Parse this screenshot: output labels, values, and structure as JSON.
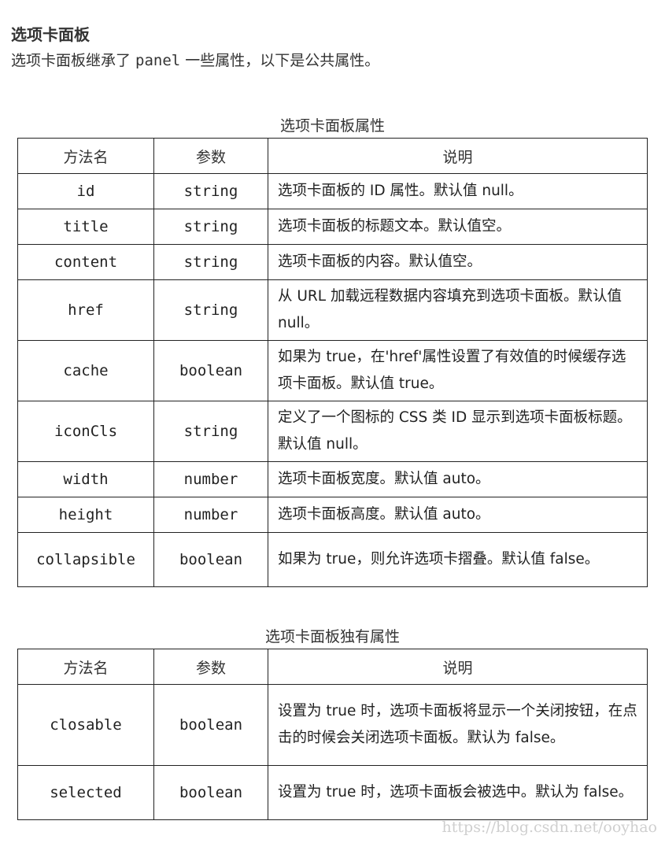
{
  "heading": "选项卡面板",
  "intro": {
    "before": "选项卡面板继承了 ",
    "code": "panel",
    "after": " 一些属性，以下是公共属性。"
  },
  "tables": [
    {
      "caption": "选项卡面板属性",
      "headers": [
        "方法名",
        "参数",
        "说明"
      ],
      "rows": [
        {
          "name": "id",
          "type": "string",
          "desc": "选项卡面板的 ID 属性。默认值 null。"
        },
        {
          "name": "title",
          "type": "string",
          "desc": "选项卡面板的标题文本。默认值空。"
        },
        {
          "name": "content",
          "type": "string",
          "desc": "选项卡面板的内容。默认值空。"
        },
        {
          "name": "href",
          "type": "string",
          "desc": "从 URL 加载远程数据内容填充到选项卡面板。默认值 null。"
        },
        {
          "name": "cache",
          "type": "boolean",
          "desc": "如果为 true，在'href'属性设置了有效值的时候缓存选项卡面板。默认值 true。"
        },
        {
          "name": "iconCls",
          "type": "string",
          "desc": "定义了一个图标的 CSS 类 ID 显示到选项卡面板标题。默认值 null。"
        },
        {
          "name": "width",
          "type": "number",
          "desc": "选项卡面板宽度。默认值 auto。"
        },
        {
          "name": "height",
          "type": "number",
          "desc": "选项卡面板高度。默认值 auto。"
        },
        {
          "name": "collapsible",
          "type": "boolean",
          "desc": "如果为 true，则允许选项卡摺叠。默认值 false。"
        }
      ]
    },
    {
      "caption": "选项卡面板独有属性",
      "headers": [
        "方法名",
        "参数",
        "说明"
      ],
      "rows": [
        {
          "name": "closable",
          "type": "boolean",
          "desc": "设置为 true 时，选项卡面板将显示一个关闭按钮，在点击的时候会关闭选项卡面板。默认为 false。"
        },
        {
          "name": "selected",
          "type": "boolean",
          "desc": "设置为 true 时，选项卡面板会被选中。默认为 false。"
        }
      ]
    }
  ],
  "watermark": "https://blog.csdn.net/ooyhao"
}
